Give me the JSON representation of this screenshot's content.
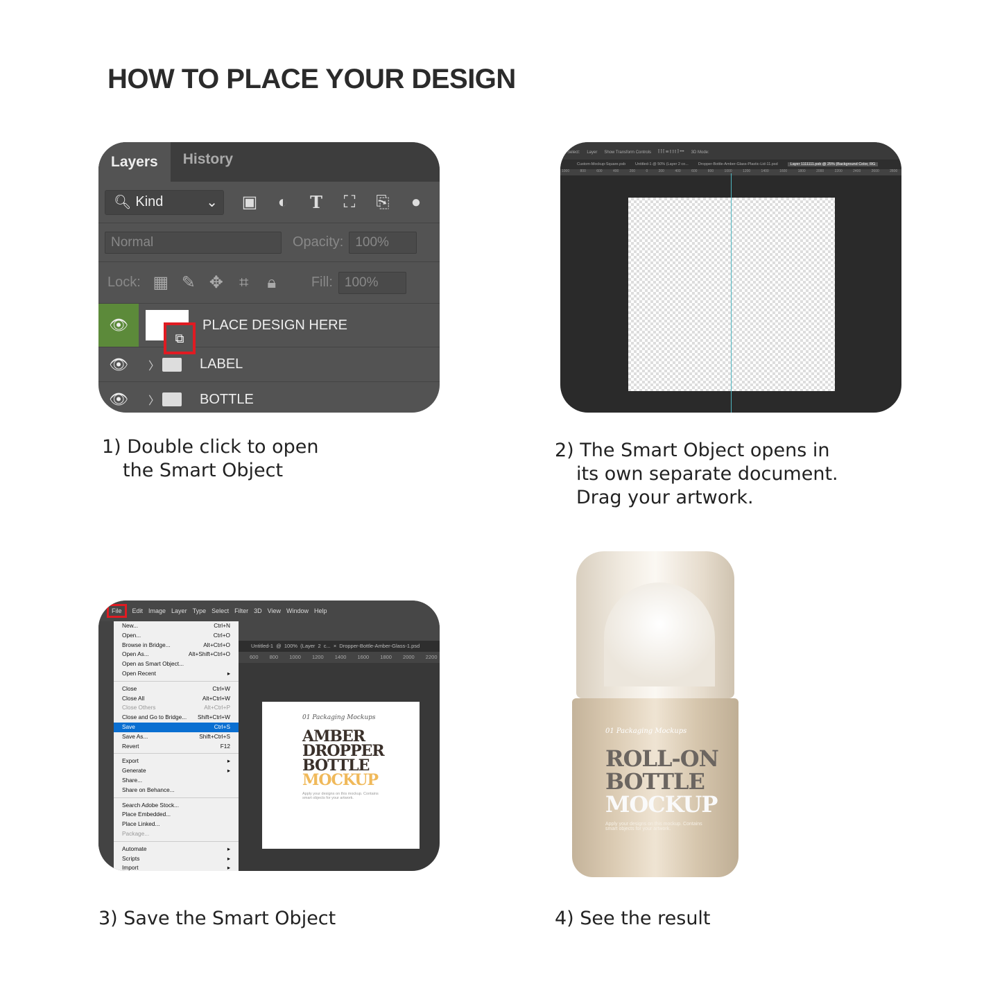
{
  "title": "HOW TO PLACE YOUR DESIGN",
  "steps": [
    {
      "lines": [
        "1) Double click to open",
        "the Smart Object"
      ]
    },
    {
      "lines": [
        "2) The Smart Object opens in",
        "its own separate document.",
        "Drag your artwork."
      ]
    },
    {
      "lines": [
        "3) Save the Smart Object"
      ]
    },
    {
      "lines": [
        "4) See the result"
      ]
    }
  ],
  "layers_panel": {
    "tabs": [
      "Layers",
      "History"
    ],
    "filter": "Kind",
    "blend_mode": "Normal",
    "opacity_label": "Opacity:",
    "opacity": "100%",
    "lock_label": "Lock:",
    "fill_label": "Fill:",
    "fill": "100%",
    "layers": [
      "PLACE DESIGN HERE",
      "LABEL",
      "BOTTLE"
    ],
    "highlight_color": "#e01b22",
    "eye_active_color": "#5c8a3a"
  },
  "smart_object_doc": {
    "options": [
      "Select:",
      "Layer",
      "Show Transform Controls",
      "3D Mode:"
    ],
    "tabs": [
      "Custom-Mockup-Square.psb",
      "Untitled-1 @ 50% (Layer 2 co...",
      "Dropper-Bottle-Amber-Glass-Plastic-Lid-11.psd",
      "Layer 1111111.psb @ 25% (Background Color, RG"
    ],
    "ruler": "1000 800 600 400 200 0 200 400 600 800 1000 1200 1400 1600 1800 2000 2200 2400 2600 2800 3000 3200 3400 3600 3800"
  },
  "file_menu": {
    "menubar": [
      "File",
      "Edit",
      "Image",
      "Layer",
      "Type",
      "Select",
      "Filter",
      "3D",
      "View",
      "Window",
      "Help"
    ],
    "groups": [
      [
        {
          "label": "New...",
          "key": "Ctrl+N"
        },
        {
          "label": "Open...",
          "key": "Ctrl+O"
        },
        {
          "label": "Browse in Bridge...",
          "key": "Alt+Ctrl+O"
        },
        {
          "label": "Open As...",
          "key": "Alt+Shift+Ctrl+O"
        },
        {
          "label": "Open as Smart Object...",
          "key": ""
        },
        {
          "label": "Open Recent",
          "key": "▸"
        }
      ],
      [
        {
          "label": "Close",
          "key": "Ctrl+W"
        },
        {
          "label": "Close All",
          "key": "Alt+Ctrl+W"
        },
        {
          "label": "Close Others",
          "key": "Alt+Ctrl+P",
          "disabled": true
        },
        {
          "label": "Close and Go to Bridge...",
          "key": "Shift+Ctrl+W"
        },
        {
          "label": "Save",
          "key": "Ctrl+S",
          "highlighted": true
        },
        {
          "label": "Save As...",
          "key": "Shift+Ctrl+S"
        },
        {
          "label": "Revert",
          "key": "F12"
        }
      ],
      [
        {
          "label": "Export",
          "key": "▸"
        },
        {
          "label": "Generate",
          "key": "▸"
        },
        {
          "label": "Share...",
          "key": ""
        },
        {
          "label": "Share on Behance...",
          "key": ""
        }
      ],
      [
        {
          "label": "Search Adobe Stock...",
          "key": ""
        },
        {
          "label": "Place Embedded...",
          "key": ""
        },
        {
          "label": "Place Linked...",
          "key": ""
        },
        {
          "label": "Package...",
          "key": "",
          "disabled": true
        }
      ],
      [
        {
          "label": "Automate",
          "key": "▸"
        },
        {
          "label": "Scripts",
          "key": "▸"
        },
        {
          "label": "Import",
          "key": "▸"
        }
      ]
    ],
    "tabs": "Untitled-1 @ 100% (Layer 2 c...   ×   Dropper-Bottle-Amber-Glass-1.psd",
    "ruler": "600 800 1000 1200 1400 1600 1800 2000 2200 2400",
    "doc": {
      "script": "01 Packaging Mockups",
      "lines": [
        "AMBER",
        "DROPPER",
        "BOTTLE"
      ],
      "accent": "MOCKUP",
      "accent_color": "#f0b95a",
      "sub": "Apply your designs on this mockup. Contains smart objects for your artwork."
    }
  },
  "result": {
    "script": "01 Packaging Mockups",
    "lines": [
      "ROLL-ON",
      "BOTTLE"
    ],
    "accent": "MOCKUP",
    "sub": "Apply your designs on this mockup. Contains smart objects for your artwork."
  }
}
